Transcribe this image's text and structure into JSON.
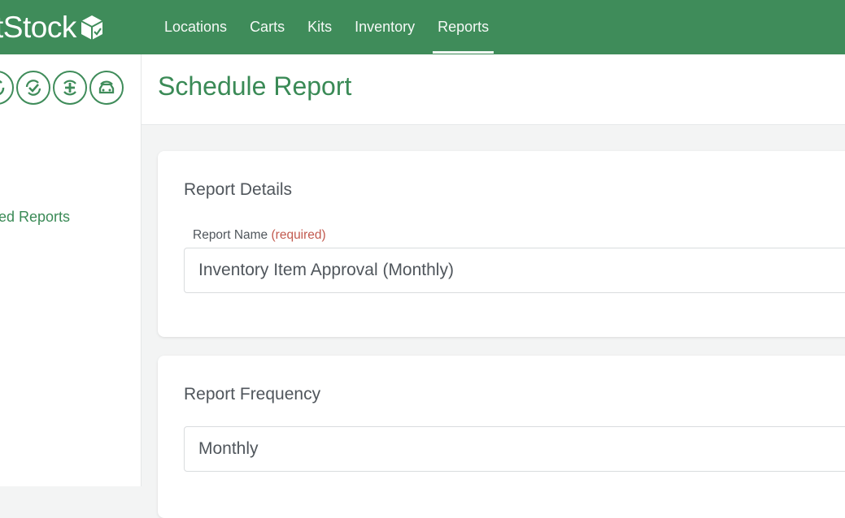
{
  "brand": {
    "name_partial": "tStock"
  },
  "nav": {
    "items": [
      {
        "label": "Locations",
        "active": false
      },
      {
        "label": "Carts",
        "active": false
      },
      {
        "label": "Kits",
        "active": false
      },
      {
        "label": "Inventory",
        "active": false
      },
      {
        "label": "Reports",
        "active": true
      }
    ]
  },
  "sidebar": {
    "icons": [
      "sync-partial-icon",
      "refresh-check-icon",
      "add-circle-icon",
      "vehicle-icon"
    ],
    "link_partial": "led Reports"
  },
  "page": {
    "title": "Schedule Report"
  },
  "report_details": {
    "title": "Report Details",
    "name_label": "Report Name",
    "name_required": "(required)",
    "name_value": "Inventory Item Approval (Monthly)"
  },
  "report_frequency": {
    "title": "Report Frequency",
    "value": "Monthly"
  },
  "colors": {
    "accent": "#3f8c5a",
    "required": "#c25a4f"
  }
}
